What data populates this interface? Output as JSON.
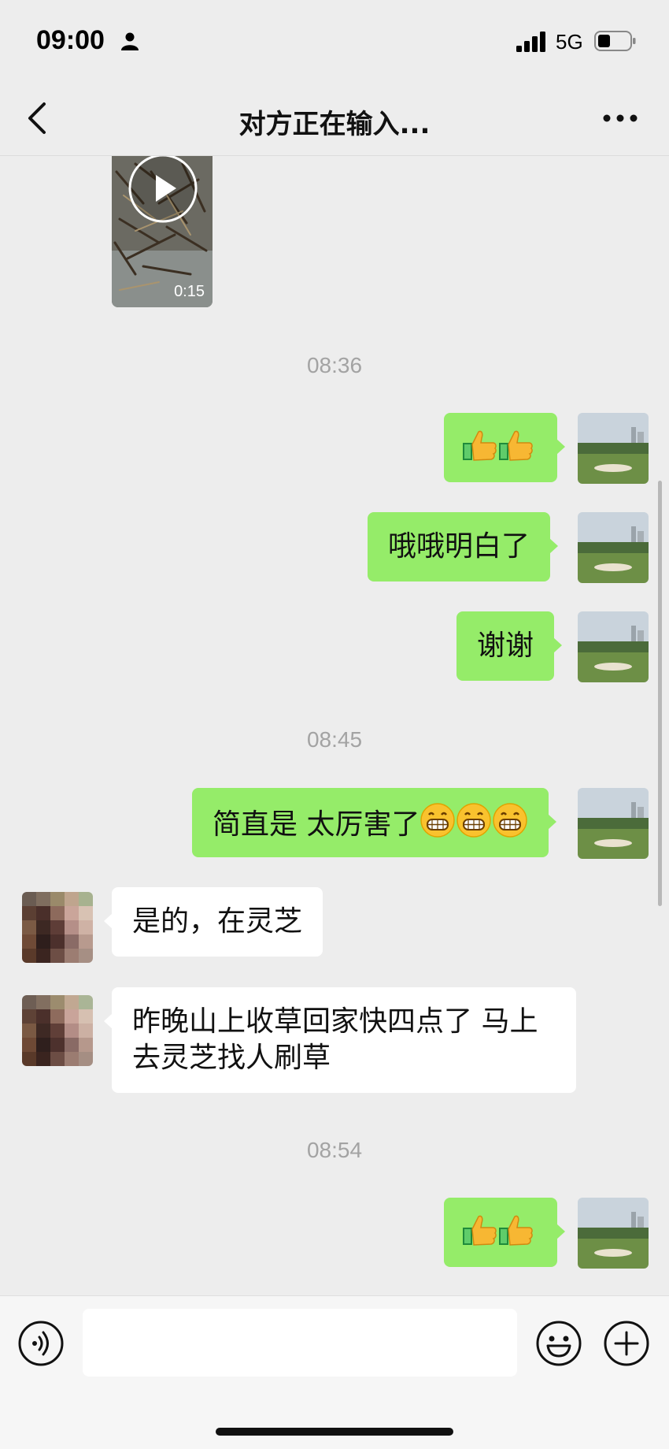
{
  "status_bar": {
    "time": "09:00",
    "network": "5G",
    "icons": [
      "person-icon",
      "signal-icon",
      "battery-icon"
    ]
  },
  "nav": {
    "title": "对方正在输入...",
    "icons": [
      "chevron-left-icon",
      "more-dots-icon"
    ]
  },
  "video": {
    "duration": "0:15",
    "icon": "play-icon"
  },
  "messages": [
    {
      "type": "timestamp",
      "text": "08:36"
    },
    {
      "type": "sent",
      "text": "",
      "emoji": [
        "thumbs-up",
        "thumbs-up"
      ]
    },
    {
      "type": "sent",
      "text": "哦哦明白了"
    },
    {
      "type": "sent",
      "text": "谢谢"
    },
    {
      "type": "timestamp",
      "text": "08:45"
    },
    {
      "type": "sent",
      "text": "简直是 太厉害了",
      "emoji": [
        "grin",
        "grin",
        "grin"
      ]
    },
    {
      "type": "received",
      "text": "是的，在灵芝"
    },
    {
      "type": "received",
      "text": "昨晚山上收草回家快四点了 马上去灵芝找人刷草"
    },
    {
      "type": "timestamp",
      "text": "08:54"
    },
    {
      "type": "sent",
      "text": "",
      "emoji": [
        "thumbs-up",
        "thumbs-up"
      ]
    }
  ],
  "input_bar": {
    "placeholder": "",
    "icons": [
      "voice-icon",
      "emoji-icon",
      "plus-icon"
    ]
  },
  "colors": {
    "background": "#ededed",
    "sent_bubble": "#95ec69",
    "received_bubble": "#ffffff",
    "timestamp": "#a3a3a3"
  }
}
